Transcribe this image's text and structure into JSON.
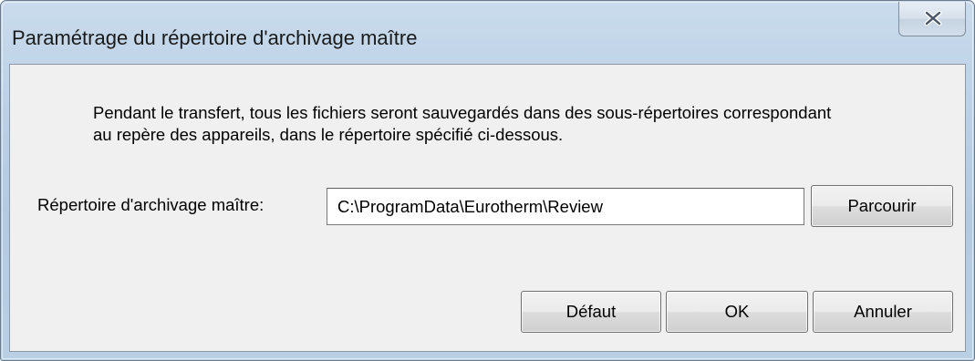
{
  "window": {
    "title": "Paramétrage du répertoire d'archivage maître"
  },
  "message": {
    "line1": "Pendant le transfert, tous les fichiers seront sauvegardés dans des sous-répertoires correspondant",
    "line2": "au repère des appareils, dans le répertoire spécifié ci-dessous."
  },
  "form": {
    "label": "Répertoire d'archivage maître:",
    "path_value": "C:\\ProgramData\\Eurotherm\\Review",
    "browse_label": "Parcourir"
  },
  "buttons": {
    "default_label": "Défaut",
    "ok_label": "OK",
    "cancel_label": "Annuler"
  },
  "icons": {
    "close": "close-icon"
  }
}
